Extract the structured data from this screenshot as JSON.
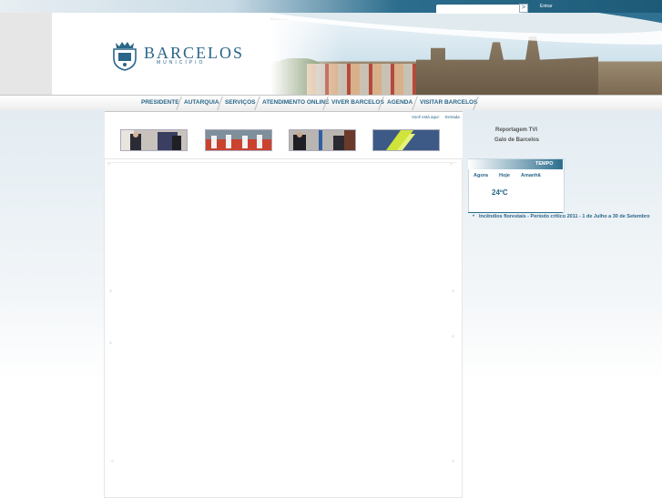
{
  "header": {
    "logo_title": "BARCELOS",
    "logo_subtitle": "MUNICÍPIO",
    "search": {
      "placeholder": "",
      "button_glyph": ">"
    },
    "login_link": "Entrar"
  },
  "nav": {
    "items": [
      {
        "label": "PRESIDENTE"
      },
      {
        "label": "AUTARQUIA"
      },
      {
        "label": "SERVIÇOS"
      },
      {
        "label": "ATENDIMENTO ONLINE"
      },
      {
        "label": "VIVER BARCELOS"
      },
      {
        "label": "AGENDA"
      },
      {
        "label": "VISITAR BARCELOS"
      }
    ]
  },
  "breadcrumb": {
    "label": "Você está aqui:",
    "current": "Entrada"
  },
  "sidebar_links": [
    {
      "label": "Reportagem TVI"
    },
    {
      "label": "Galo de Barcelos"
    }
  ],
  "weather": {
    "title": "TEMPO",
    "tabs": [
      "Agora",
      "Hoje",
      "Amanhã"
    ],
    "temperature": "24ºC"
  },
  "news": [
    {
      "label": "Incêndios florestais - Período crítico 2011 - 1 de Julho a 30 de Setembro"
    }
  ],
  "colors": {
    "brand_blue": "#2a6689",
    "header_band": "#2c6d8d"
  }
}
